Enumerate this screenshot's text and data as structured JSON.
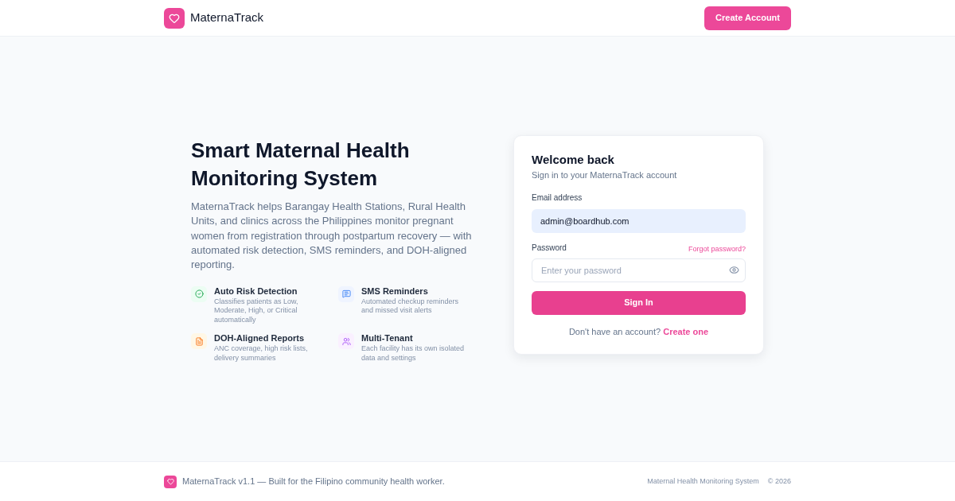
{
  "header": {
    "brand": "MaternaTrack",
    "button": "Create Account"
  },
  "hero": {
    "title": "Smart Maternal Health Monitoring System",
    "description": "MaternaTrack helps Barangay Health Stations, Rural Health Units, and clinics across the Philippines monitor pregnant women from registration through postpartum recovery — with automated risk detection, SMS reminders, and DOH-aligned reporting.",
    "features": [
      {
        "kind": "check",
        "title": "Auto Risk Detection",
        "description": "Classifies patients as Low, Moderate, High, or Critical automatically"
      },
      {
        "kind": "message",
        "title": "SMS Reminders",
        "description": "Automated checkup reminders and missed visit alerts"
      },
      {
        "kind": "report",
        "title": "DOH-Aligned Reports",
        "description": "ANC coverage, high risk lists, delivery summaries"
      },
      {
        "kind": "users",
        "title": "Multi-Tenant",
        "description": "Each facility has its own isolated data and settings"
      }
    ]
  },
  "login": {
    "title": "Welcome back",
    "subtitle": "Sign in to your MaternaTrack account",
    "email": {
      "label": "Email address",
      "value": "admin@boardhub.com"
    },
    "password": {
      "label": "Password",
      "placeholder": "Enter your password",
      "forgot_link": "Forgot password?"
    },
    "submit": "Sign In",
    "signup_prompt": "Don't have an account?",
    "signup_link": "Create one"
  },
  "footer": {
    "text": "MaternaTrack v1.1 — Built for the Filipino community health worker.",
    "tagline": "Maternal Health Monitoring System",
    "copyright": "© 2026"
  }
}
